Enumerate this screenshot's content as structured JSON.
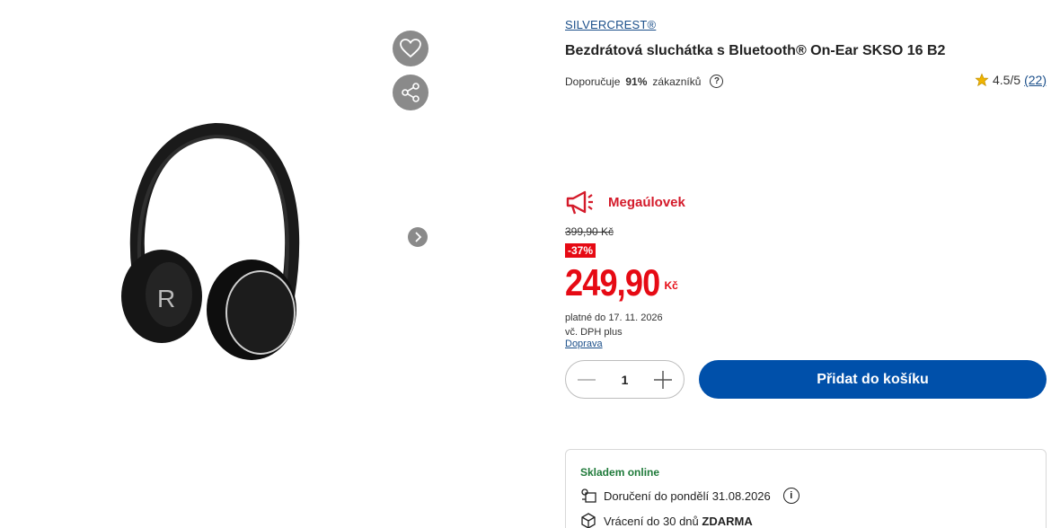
{
  "product": {
    "brand": "SILVERCREST®",
    "title": "Bezdrátová sluchátka s Bluetooth® On-Ear SKSO 16 B2",
    "image_alt": "headphones",
    "image_logo_letter": "R"
  },
  "recommend": {
    "prefix": "Doporučuje",
    "percent": "91%",
    "suffix": "zákazníků",
    "help_symbol": "?"
  },
  "rating": {
    "score": "4.5/5",
    "count": "(22)"
  },
  "promo": {
    "label": "Megaúlovek"
  },
  "pricing": {
    "old_price": "399,90 Kč",
    "discount": "-37%",
    "price": "249,90",
    "currency": "Kč",
    "valid_until": "platné do 17. 11. 2026",
    "vat_note": "vč. DPH plus",
    "shipping_link": "Doprava"
  },
  "cart": {
    "quantity": "1",
    "add_label": "Přidat do košíku"
  },
  "stock": {
    "status": "Skladem online",
    "delivery": "Doručení do pondělí 31.08.2026",
    "return_prefix": "Vrácení do 30 dnů",
    "return_free": "ZDARMA"
  },
  "colors": {
    "accent_blue": "#0050aa",
    "price_red": "#e60a14",
    "stock_green": "#1f7a3a"
  }
}
